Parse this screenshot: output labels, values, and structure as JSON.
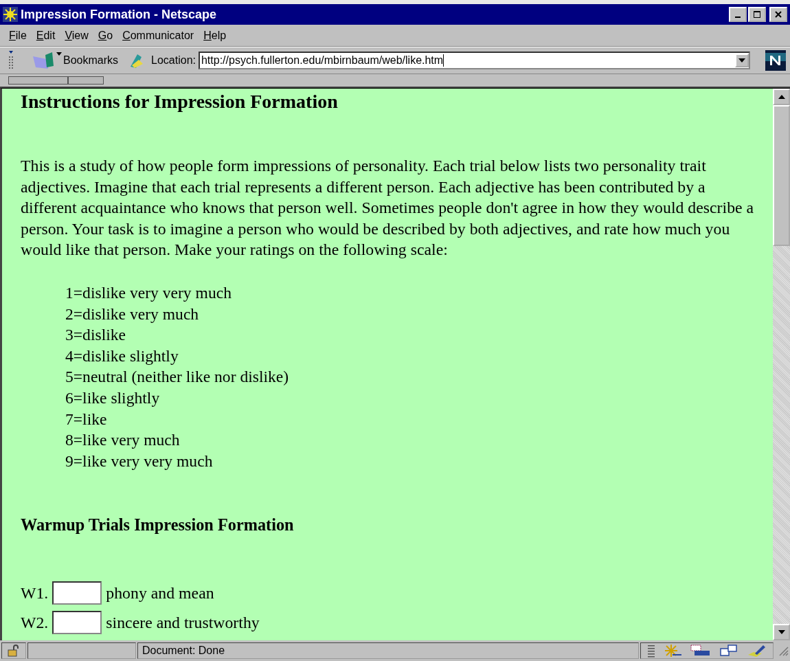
{
  "window": {
    "title": "Impression Formation - Netscape"
  },
  "menu": [
    {
      "label": "File"
    },
    {
      "label": "Edit"
    },
    {
      "label": "View"
    },
    {
      "label": "Go"
    },
    {
      "label": "Communicator"
    },
    {
      "label": "Help"
    }
  ],
  "toolbar": {
    "bookmarks": "Bookmarks",
    "location_label": "Location:",
    "url": "http://psych.fullerton.edu/mbirnbaum/web/like.htm"
  },
  "page": {
    "heading": "Instructions for Impression Formation",
    "intro": "This is a study of how people form impressions of personality. Each trial below lists two personality trait adjectives. Imagine that each trial represents a different person. Each adjective has been contributed by a different acquaintance who knows that person well. Sometimes people don't agree in how they would describe a person.  Your task is to imagine a person who would be described by both adjectives, and rate how much you would like that person. Make your ratings on the following scale:",
    "scale": [
      "1=dislike very very much",
      "2=dislike very much",
      "3=dislike",
      "4=dislike slightly",
      "5=neutral (neither like nor dislike)",
      "6=like slightly",
      "7=like",
      "8=like very much",
      "9=like very very much"
    ],
    "warmup_heading": "Warmup Trials Impression Formation",
    "trials": [
      {
        "label": "W1.",
        "adjectives": "phony and mean"
      },
      {
        "label": "W2.",
        "adjectives": "sincere and trustworthy"
      }
    ]
  },
  "status_bar": {
    "text": "Document: Done"
  }
}
